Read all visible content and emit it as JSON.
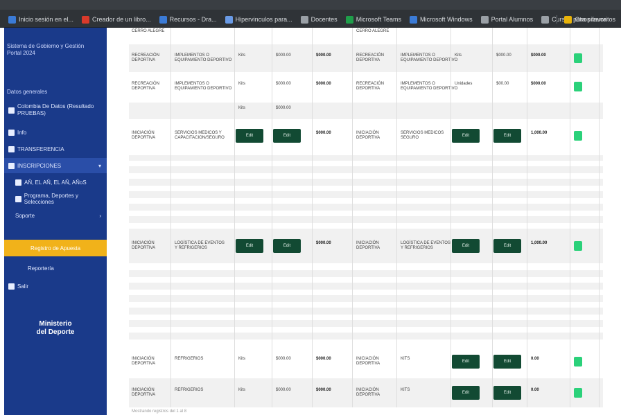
{
  "browser": {
    "bookmarks": [
      {
        "label": "Inicio sesión en el...",
        "color": "#3b7bd6"
      },
      {
        "label": "Creador de un libro...",
        "color": "#d93a2b"
      },
      {
        "label": "Recursos - Dra...",
        "color": "#3b7bd6"
      },
      {
        "label": "Hipervinculos para...",
        "color": "#6a9be6"
      },
      {
        "label": "Docentes",
        "color": "#9aa0a6"
      },
      {
        "label": "Microsoft Teams",
        "color": "#1f9e4a"
      },
      {
        "label": "Microsoft Windows",
        "color": "#3b7bd6"
      },
      {
        "label": "Portal Alumnos",
        "color": "#9aa0a6"
      },
      {
        "label": "Cursos para pizarra",
        "color": "#9aa0a6"
      }
    ],
    "right_folder": "Otros favoritos"
  },
  "sidebar": {
    "top_text": "Sistema de Gobierno y Gestión\nPortal 2024",
    "section_label": "Datos generales",
    "items": [
      {
        "label": "Colombia De Datos (Resultado\nPRUEBAS)",
        "icon": "building-icon"
      },
      {
        "label": "Info",
        "icon": "person-icon"
      },
      {
        "label": "TRANSFERENCIA",
        "icon": "transfer-icon"
      },
      {
        "label": "INSCRIPCIONES",
        "icon": "list-icon"
      },
      {
        "label": "AÑ, EL AÑ, EL AÑ, AÑoS",
        "icon": "doc-icon"
      },
      {
        "label": "Programa, Deportes y Selecciones",
        "icon": "doc-icon"
      },
      {
        "label": "Soporte",
        "icon": "support-icon"
      },
      {
        "label": "Registro de Apuesta",
        "icon": ""
      },
      {
        "label": "Reportería",
        "icon": ""
      },
      {
        "label": "Salir",
        "icon": "exit-icon"
      }
    ],
    "logo": "Ministerio\ndel Deporte"
  },
  "table": {
    "rows": [
      {
        "c1": "CERRO ALEGRE",
        "c2": "",
        "c3": "",
        "c4": "",
        "c5": "",
        "c6": "CERRO ALEGRE",
        "c7": "",
        "c8": "",
        "c9": "",
        "c10": "",
        "type": "text"
      },
      {
        "c1": "RECREACIÓN\nDEPORTIVA",
        "c2": "IMPLEMENTOS O\nEQUIPAMIENTO DEPORTIVO",
        "c3": "Kits",
        "c4": "$000.00",
        "c5": "$000.00",
        "c6": "RECREACIÓN\nDEPORTIVA",
        "c7": "IMPLEMENTOS O\nEQUIPAMIENTO DEPORTIVO",
        "c8": "Kits",
        "c9": "$000.00",
        "c10": "$000.00",
        "type": "text"
      },
      {
        "c1": "RECREACIÓN\nDEPORTIVA",
        "c2": "IMPLEMENTOS O\nEQUIPAMIENTO DEPORTIVO",
        "c3": "Kits",
        "c4": "$000.00",
        "c5": "$000.00",
        "c6": "RECREACIÓN\nDEPORTIVA",
        "c7": "IMPLEMENTOS O\nEQUIPAMIENTO DEPORTIVO",
        "c8": "Unidades",
        "c9": "$00.00",
        "c10": "$000.00",
        "type": "text"
      },
      {
        "c1": "",
        "c2": "",
        "c3": "Kits",
        "c4": "$000.00",
        "c5": "",
        "c6": "",
        "c7": "",
        "c8": "",
        "c9": "",
        "c10": "",
        "type": "text"
      },
      {
        "c1": "INICIACIÓN\nDEPORTIVA",
        "c2": "SERVICIOS MEDICOS Y\nCAPACITACION/SEGURO",
        "c3": "Edit",
        "c4": "Edit",
        "c5": "$000.00",
        "c6": "INICIACIÓN\nDEPORTIVA",
        "c7": "SERVICIOS MEDICOS\nSEGURO",
        "c8": "Edit",
        "c9": "Edit",
        "c10": "1,000.00",
        "type": "buttons"
      },
      {
        "c1": "INICIACIÓN\nDEPORTIVA",
        "c2": "LOGÍSTICA DE EVENTOS\nY REFRIGERIOS",
        "c3": "Edit",
        "c4": "Edit",
        "c5": "$000.00",
        "c6": "INICIACIÓN\nDEPORTIVA",
        "c7": "LOGÍSTICA DE EVENTOS\nY REFRIGERIOS",
        "c8": "Edit",
        "c9": "Edit",
        "c10": "1,000.00",
        "type": "buttons"
      },
      {
        "c1": "INICIACIÓN\nDEPORTIVA",
        "c2": "REFRIGERIOS",
        "c3": "Kits",
        "c4": "$000.00",
        "c5": "$000.00",
        "c6": "INICIACIÓN\nDEPORTIVA",
        "c7": "KITS",
        "c8": "Edit",
        "c9": "Edit",
        "c10": "0.00",
        "type": "mixed"
      },
      {
        "c1": "INICIACIÓN\nDEPORTIVA",
        "c2": "REFRIGERIOS",
        "c3": "Kits",
        "c4": "$000.00",
        "c5": "$000.00",
        "c6": "INICIACIÓN\nDEPORTIVA",
        "c7": "KITS",
        "c8": "Edit",
        "c9": "Edit",
        "c10": "0.00",
        "type": "mixed"
      }
    ],
    "footer": "Mostrando registros del 1 al 8"
  }
}
